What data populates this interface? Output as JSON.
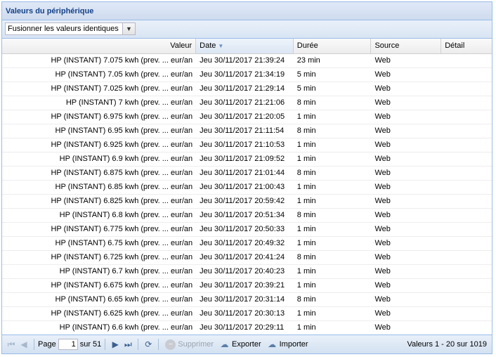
{
  "panel": {
    "title": "Valeurs du périphérique"
  },
  "toolbar": {
    "merge_select": "Fusionner les valeurs identiques"
  },
  "columns": {
    "valeur": "Valeur",
    "date": "Date",
    "duree": "Durée",
    "source": "Source",
    "detail": "Détail"
  },
  "rows": [
    {
      "valeur": "HP (INSTANT) 7.075 kwh (prev. ... eur/an",
      "date": "Jeu 30/11/2017 21:39:24",
      "duree": "23 min",
      "source": "Web",
      "detail": ""
    },
    {
      "valeur": "HP (INSTANT) 7.05 kwh (prev. ... eur/an",
      "date": "Jeu 30/11/2017 21:34:19",
      "duree": "5 min",
      "source": "Web",
      "detail": ""
    },
    {
      "valeur": "HP (INSTANT) 7.025 kwh (prev. ... eur/an",
      "date": "Jeu 30/11/2017 21:29:14",
      "duree": "5 min",
      "source": "Web",
      "detail": ""
    },
    {
      "valeur": "HP (INSTANT) 7 kwh (prev. ... eur/an",
      "date": "Jeu 30/11/2017 21:21:06",
      "duree": "8 min",
      "source": "Web",
      "detail": ""
    },
    {
      "valeur": "HP (INSTANT) 6.975 kwh (prev. ... eur/an",
      "date": "Jeu 30/11/2017 21:20:05",
      "duree": "1 min",
      "source": "Web",
      "detail": ""
    },
    {
      "valeur": "HP (INSTANT) 6.95 kwh (prev. ... eur/an",
      "date": "Jeu 30/11/2017 21:11:54",
      "duree": "8 min",
      "source": "Web",
      "detail": ""
    },
    {
      "valeur": "HP (INSTANT) 6.925 kwh (prev. ... eur/an",
      "date": "Jeu 30/11/2017 21:10:53",
      "duree": "1 min",
      "source": "Web",
      "detail": ""
    },
    {
      "valeur": "HP (INSTANT) 6.9 kwh (prev. ... eur/an",
      "date": "Jeu 30/11/2017 21:09:52",
      "duree": "1 min",
      "source": "Web",
      "detail": ""
    },
    {
      "valeur": "HP (INSTANT) 6.875 kwh (prev. ... eur/an",
      "date": "Jeu 30/11/2017 21:01:44",
      "duree": "8 min",
      "source": "Web",
      "detail": ""
    },
    {
      "valeur": "HP (INSTANT) 6.85 kwh (prev. ... eur/an",
      "date": "Jeu 30/11/2017 21:00:43",
      "duree": "1 min",
      "source": "Web",
      "detail": ""
    },
    {
      "valeur": "HP (INSTANT) 6.825 kwh (prev. ... eur/an",
      "date": "Jeu 30/11/2017 20:59:42",
      "duree": "1 min",
      "source": "Web",
      "detail": ""
    },
    {
      "valeur": "HP (INSTANT) 6.8 kwh (prev. ... eur/an",
      "date": "Jeu 30/11/2017 20:51:34",
      "duree": "8 min",
      "source": "Web",
      "detail": ""
    },
    {
      "valeur": "HP (INSTANT) 6.775 kwh (prev. ... eur/an",
      "date": "Jeu 30/11/2017 20:50:33",
      "duree": "1 min",
      "source": "Web",
      "detail": ""
    },
    {
      "valeur": "HP (INSTANT) 6.75 kwh (prev. ... eur/an",
      "date": "Jeu 30/11/2017 20:49:32",
      "duree": "1 min",
      "source": "Web",
      "detail": ""
    },
    {
      "valeur": "HP (INSTANT) 6.725 kwh (prev. ... eur/an",
      "date": "Jeu 30/11/2017 20:41:24",
      "duree": "8 min",
      "source": "Web",
      "detail": ""
    },
    {
      "valeur": "HP (INSTANT) 6.7 kwh (prev. ... eur/an",
      "date": "Jeu 30/11/2017 20:40:23",
      "duree": "1 min",
      "source": "Web",
      "detail": ""
    },
    {
      "valeur": "HP (INSTANT) 6.675 kwh (prev. ... eur/an",
      "date": "Jeu 30/11/2017 20:39:21",
      "duree": "1 min",
      "source": "Web",
      "detail": ""
    },
    {
      "valeur": "HP (INSTANT) 6.65 kwh (prev. ... eur/an",
      "date": "Jeu 30/11/2017 20:31:14",
      "duree": "8 min",
      "source": "Web",
      "detail": ""
    },
    {
      "valeur": "HP (INSTANT) 6.625 kwh (prev. ... eur/an",
      "date": "Jeu 30/11/2017 20:30:13",
      "duree": "1 min",
      "source": "Web",
      "detail": ""
    },
    {
      "valeur": "HP (INSTANT) 6.6 kwh (prev. ... eur/an",
      "date": "Jeu 30/11/2017 20:29:11",
      "duree": "1 min",
      "source": "Web",
      "detail": ""
    }
  ],
  "pager": {
    "page_label": "Page",
    "page_value": "1",
    "of_label": "sur 51",
    "delete_label": "Supprimer",
    "export_label": "Exporter",
    "import_label": "Importer",
    "status": "Valeurs 1 - 20 sur 1019"
  },
  "icons": {
    "first": "first-page-icon",
    "prev": "prev-page-icon",
    "next": "next-page-icon",
    "last": "last-page-icon",
    "refresh": "refresh-icon",
    "delete": "minus-circle-icon",
    "export": "cloud-upload-icon",
    "import": "cloud-download-icon"
  },
  "colors": {
    "header_text": "#15428b",
    "border": "#99bbe8"
  }
}
